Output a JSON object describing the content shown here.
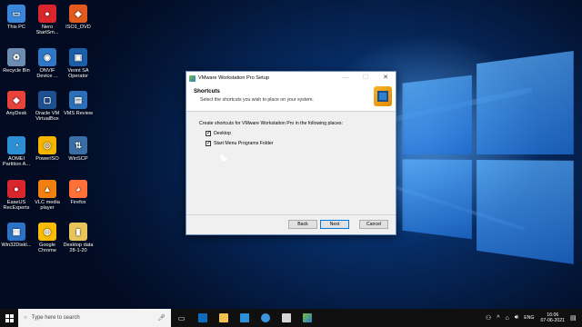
{
  "desktop_icons": [
    {
      "label": "This PC",
      "color": "#3a86d9",
      "glyph": "▭"
    },
    {
      "label": "Nero\nStartSm...",
      "color": "#d8262c",
      "glyph": "●"
    },
    {
      "label": "ISO1_DVD",
      "color": "#e35a1e",
      "glyph": "◆"
    },
    {
      "label": "Recycle Bin",
      "color": "#6d8eb3",
      "glyph": "♻"
    },
    {
      "label": "ONVIF\nDevice ...",
      "color": "#2f78c8",
      "glyph": "◉"
    },
    {
      "label": "Verint SA\nOperator",
      "color": "#1c5fa8",
      "glyph": "▣"
    },
    {
      "label": "AnyDesk",
      "color": "#e8433b",
      "glyph": "◆"
    },
    {
      "label": "Oracle VM\nVirtualBox",
      "color": "#1d4f91",
      "glyph": "▢"
    },
    {
      "label": "VMS Review",
      "color": "#2c6fb8",
      "glyph": "▤"
    },
    {
      "label": "AOMEI\nPartition A...",
      "color": "#2c8fd4",
      "glyph": "◔"
    },
    {
      "label": "PowerISO",
      "color": "#f4b400",
      "glyph": "◎"
    },
    {
      "label": "WinSCP",
      "color": "#3b6ea5",
      "glyph": "⇅"
    },
    {
      "label": "EaseUS\nRecExperts",
      "color": "#d8262c",
      "glyph": "●"
    },
    {
      "label": "VLC media\nplayer",
      "color": "#f08010",
      "glyph": "▲"
    },
    {
      "label": "Firefox",
      "color": "#ff7139",
      "glyph": "◕"
    },
    {
      "label": "Win32DiskI...",
      "color": "#2a73c7",
      "glyph": "▦"
    },
    {
      "label": "Google\nChrome",
      "color": "#fbbc05",
      "glyph": "◍"
    },
    {
      "label": "Desktop data\n28-1-20",
      "color": "#e8c45a",
      "glyph": "▮"
    }
  ],
  "dialog": {
    "title": "VMware Workstation Pro Setup",
    "heading": "Shortcuts",
    "subheading": "Select the shortcuts you wish to place on your system.",
    "instruction": "Create shortcuts for VMware Workstation Pro in the following places:",
    "checkbox_desktop": "Desktop",
    "checkbox_startmenu": "Start Menu Programs Folder",
    "back_label": "Back",
    "next_label": "Next",
    "cancel_label": "Cancel",
    "minimize": "—",
    "maximize": "☐",
    "close": "✕"
  },
  "taskbar": {
    "search_placeholder": "Type here to search",
    "language": "ENG",
    "time": "16:06",
    "date": "07-06-2021"
  }
}
